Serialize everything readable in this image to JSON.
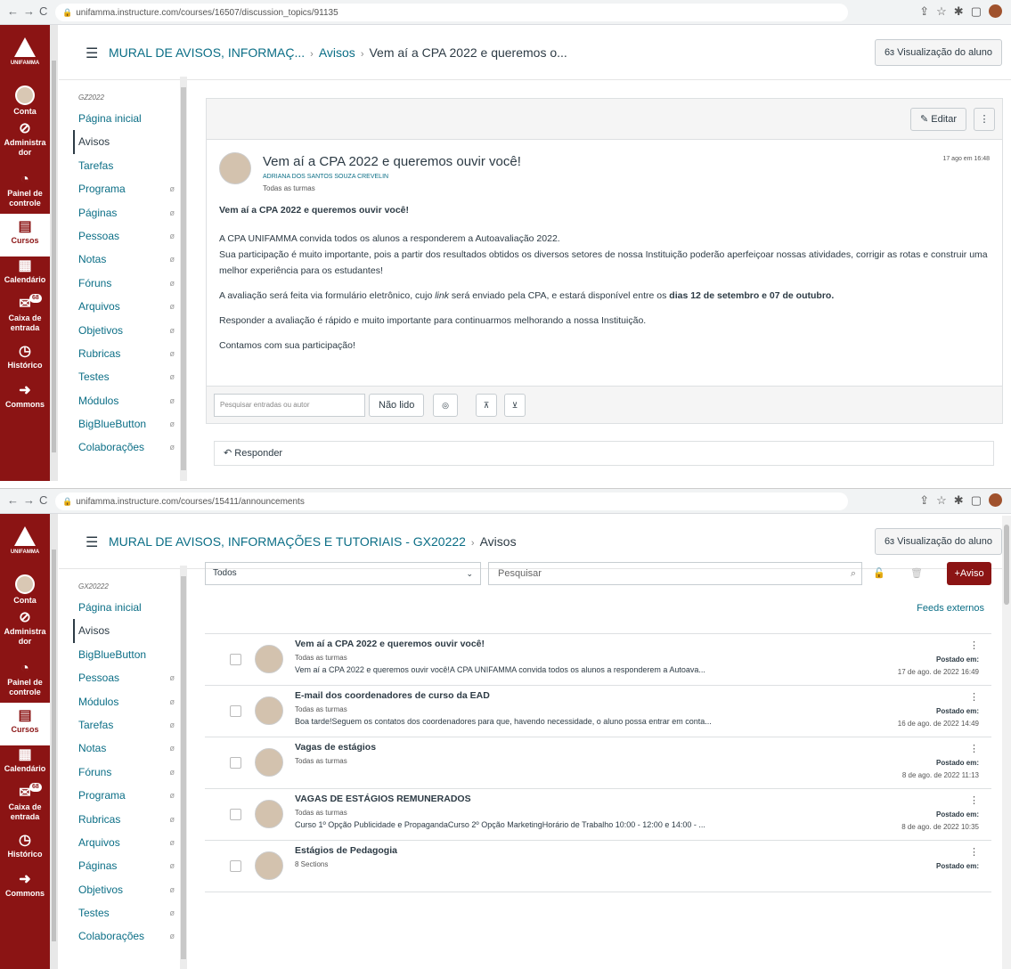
{
  "shot1": {
    "url": "unifamma.instructure.com/courses/16507/discussion_topics/91135",
    "breadcrumb": [
      "MURAL DE AVISOS, INFORMAÇ...",
      "Avisos",
      "Vem aí a CPA 2022 e queremos o..."
    ],
    "student_view": "Visualização do aluno",
    "term": "GZ2022",
    "nav": [
      {
        "label": "Página inicial",
        "eye": false
      },
      {
        "label": "Avisos",
        "eye": false,
        "active": true
      },
      {
        "label": "Tarefas",
        "eye": false
      },
      {
        "label": "Programa",
        "eye": true
      },
      {
        "label": "Páginas",
        "eye": true
      },
      {
        "label": "Pessoas",
        "eye": true
      },
      {
        "label": "Notas",
        "eye": true
      },
      {
        "label": "Fóruns",
        "eye": true
      },
      {
        "label": "Arquivos",
        "eye": true
      },
      {
        "label": "Objetivos",
        "eye": true
      },
      {
        "label": "Rubricas",
        "eye": true
      },
      {
        "label": "Testes",
        "eye": true
      },
      {
        "label": "Módulos",
        "eye": true
      },
      {
        "label": "BigBlueButton",
        "eye": true
      },
      {
        "label": "Colaborações",
        "eye": true
      }
    ],
    "edit_label": "Editar",
    "post": {
      "title": "Vem aí a CPA 2022 e queremos ouvir você!",
      "author": "ADRIANA DOS SANTOS SOUZA CREVELIN",
      "sections": "Todas as turmas",
      "date": "17 ago em 16:48",
      "heading": "Vem aí a CPA 2022 e queremos ouvir você!",
      "p1": "A CPA UNIFAMMA convida todos os alunos a responderem a Autoavaliação 2022.",
      "p2": "Sua participação é muito importante, pois a partir dos resultados obtidos os diversos setores de nossa Instituição poderão aperfeiçoar nossas atividades, corrigir as rotas e construir uma melhor experiência para os estudantes!",
      "p3a": "A avaliação será feita via formulário eletrônico, cujo ",
      "p3link": "link",
      "p3b": " será enviado pela CPA, e estará disponível entre os ",
      "p3bold": "dias 12 de setembro e 07 de outubro.",
      "p4": "Responder a avaliação é rápido e muito importante para continuarmos melhorando a nossa Instituição.",
      "p5": "Contamos com sua participação!"
    },
    "search_placeholder": "Pesquisar entradas ou autor",
    "unread_label": "Não lido",
    "reply_label": "Responder"
  },
  "shot2": {
    "url": "unifamma.instructure.com/courses/15411/announcements",
    "breadcrumb": [
      "MURAL DE AVISOS, INFORMAÇÕES E TUTORIAIS - GX20222",
      "Avisos"
    ],
    "student_view": "Visualização do aluno",
    "term": "GX20222",
    "nav": [
      {
        "label": "Página inicial",
        "eye": false
      },
      {
        "label": "Avisos",
        "eye": false,
        "active": true
      },
      {
        "label": "BigBlueButton",
        "eye": false
      },
      {
        "label": "Pessoas",
        "eye": true
      },
      {
        "label": "Módulos",
        "eye": true
      },
      {
        "label": "Tarefas",
        "eye": true
      },
      {
        "label": "Notas",
        "eye": true
      },
      {
        "label": "Fóruns",
        "eye": true
      },
      {
        "label": "Programa",
        "eye": true
      },
      {
        "label": "Rubricas",
        "eye": true
      },
      {
        "label": "Arquivos",
        "eye": true
      },
      {
        "label": "Páginas",
        "eye": true
      },
      {
        "label": "Objetivos",
        "eye": true
      },
      {
        "label": "Testes",
        "eye": true
      },
      {
        "label": "Colaborações",
        "eye": true
      }
    ],
    "filter_value": "Todos",
    "search_placeholder": "Pesquisar",
    "add_label": "+Aviso",
    "feeds_label": "Feeds externos",
    "posted_label": "Postado em:",
    "announcements": [
      {
        "title": "Vem aí a CPA 2022 e queremos ouvir você!",
        "sections": "Todas as turmas",
        "snippet": "Vem aí a CPA 2022 e queremos ouvir você!A CPA UNIFAMMA convida todos os alunos a responderem a Autoava...",
        "date": "17 de ago. de 2022 16:49"
      },
      {
        "title": "E-mail dos coordenadores de curso da EAD",
        "sections": "Todas as turmas",
        "snippet": "Boa tarde!Seguem os contatos dos coordenadores para que, havendo necessidade, o aluno possa entrar em conta...",
        "date": "16 de ago. de 2022 14:49"
      },
      {
        "title": "Vagas de estágios",
        "sections": "Todas as turmas",
        "snippet": "",
        "date": "8 de ago. de 2022 11:13"
      },
      {
        "title": "VAGAS DE ESTÁGIOS REMUNERADOS",
        "sections": "Todas as turmas",
        "snippet": "Curso 1º Opção Publicidade e PropagandaCurso 2º Opção MarketingHorário de Trabalho 10:00 - 12:00 e 14:00 - ...",
        "date": "8 de ago. de 2022 10:35"
      },
      {
        "title": "Estágios de Pedagogia",
        "sections": "8 Sections",
        "snippet": "",
        "date": ""
      }
    ]
  },
  "global_nav": {
    "brand": "UNIFAMMA",
    "items": [
      "Conta",
      "Administra dor",
      "Painel de controle",
      "Cursos",
      "Calendário",
      "Caixa de entrada",
      "Histórico",
      "Commons"
    ],
    "inbox_badge": "68"
  },
  "colors": {
    "brand": "#8b1414",
    "link": "#0b6e86"
  }
}
